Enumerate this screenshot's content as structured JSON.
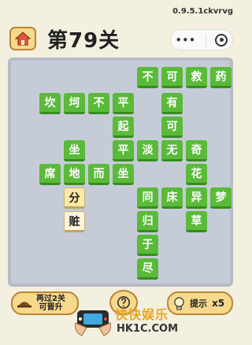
{
  "version": "0.9.5.1ckvrvg",
  "header": {
    "level_title": "第79关"
  },
  "tiles": [
    {
      "id": "r1c1",
      "text": "不"
    },
    {
      "id": "r1c2",
      "text": "可"
    },
    {
      "id": "r1c3",
      "text": "救"
    },
    {
      "id": "r1c4",
      "text": "药"
    },
    {
      "id": "r2c1",
      "text": "坎"
    },
    {
      "id": "r2c2",
      "text": "坷"
    },
    {
      "id": "r2c3",
      "text": "不"
    },
    {
      "id": "r2c4",
      "text": "平"
    },
    {
      "id": "r2c5",
      "text": "有"
    },
    {
      "id": "r3c1",
      "text": "起"
    },
    {
      "id": "r3c2",
      "text": "可"
    },
    {
      "id": "r4c1",
      "text": "坐"
    },
    {
      "id": "r4c2",
      "text": "平"
    },
    {
      "id": "r4c3",
      "text": "淡"
    },
    {
      "id": "r4c4",
      "text": "无"
    },
    {
      "id": "r4c5",
      "text": "奇"
    },
    {
      "id": "r5c1",
      "text": "席"
    },
    {
      "id": "r5c2",
      "text": "地"
    },
    {
      "id": "r5c3",
      "text": "而"
    },
    {
      "id": "r5c4",
      "text": "坐"
    },
    {
      "id": "r5c5",
      "text": "花"
    },
    {
      "id": "r6c1",
      "text": "分"
    },
    {
      "id": "r6c2",
      "text": "同"
    },
    {
      "id": "r6c3",
      "text": "床"
    },
    {
      "id": "r6c4",
      "text": "异"
    },
    {
      "id": "r6c5",
      "text": "梦"
    },
    {
      "id": "r7c1",
      "text": "赃"
    },
    {
      "id": "r7c2",
      "text": "归"
    },
    {
      "id": "r7c3",
      "text": "草"
    },
    {
      "id": "r8c1",
      "text": "于"
    },
    {
      "id": "r9c1",
      "text": "尽"
    }
  ],
  "buttons": {
    "replay_line1": "再过2关",
    "replay_line2": "可晋升",
    "hint_label": "提示",
    "hint_count": "x5"
  },
  "watermark": {
    "cn": "快快娱乐",
    "en": "HK1C.COM"
  },
  "colors": {
    "tile_green": "#5aba39",
    "board": "#c5ccd7",
    "background": "#f3f0df",
    "button": "#f7d98c"
  }
}
